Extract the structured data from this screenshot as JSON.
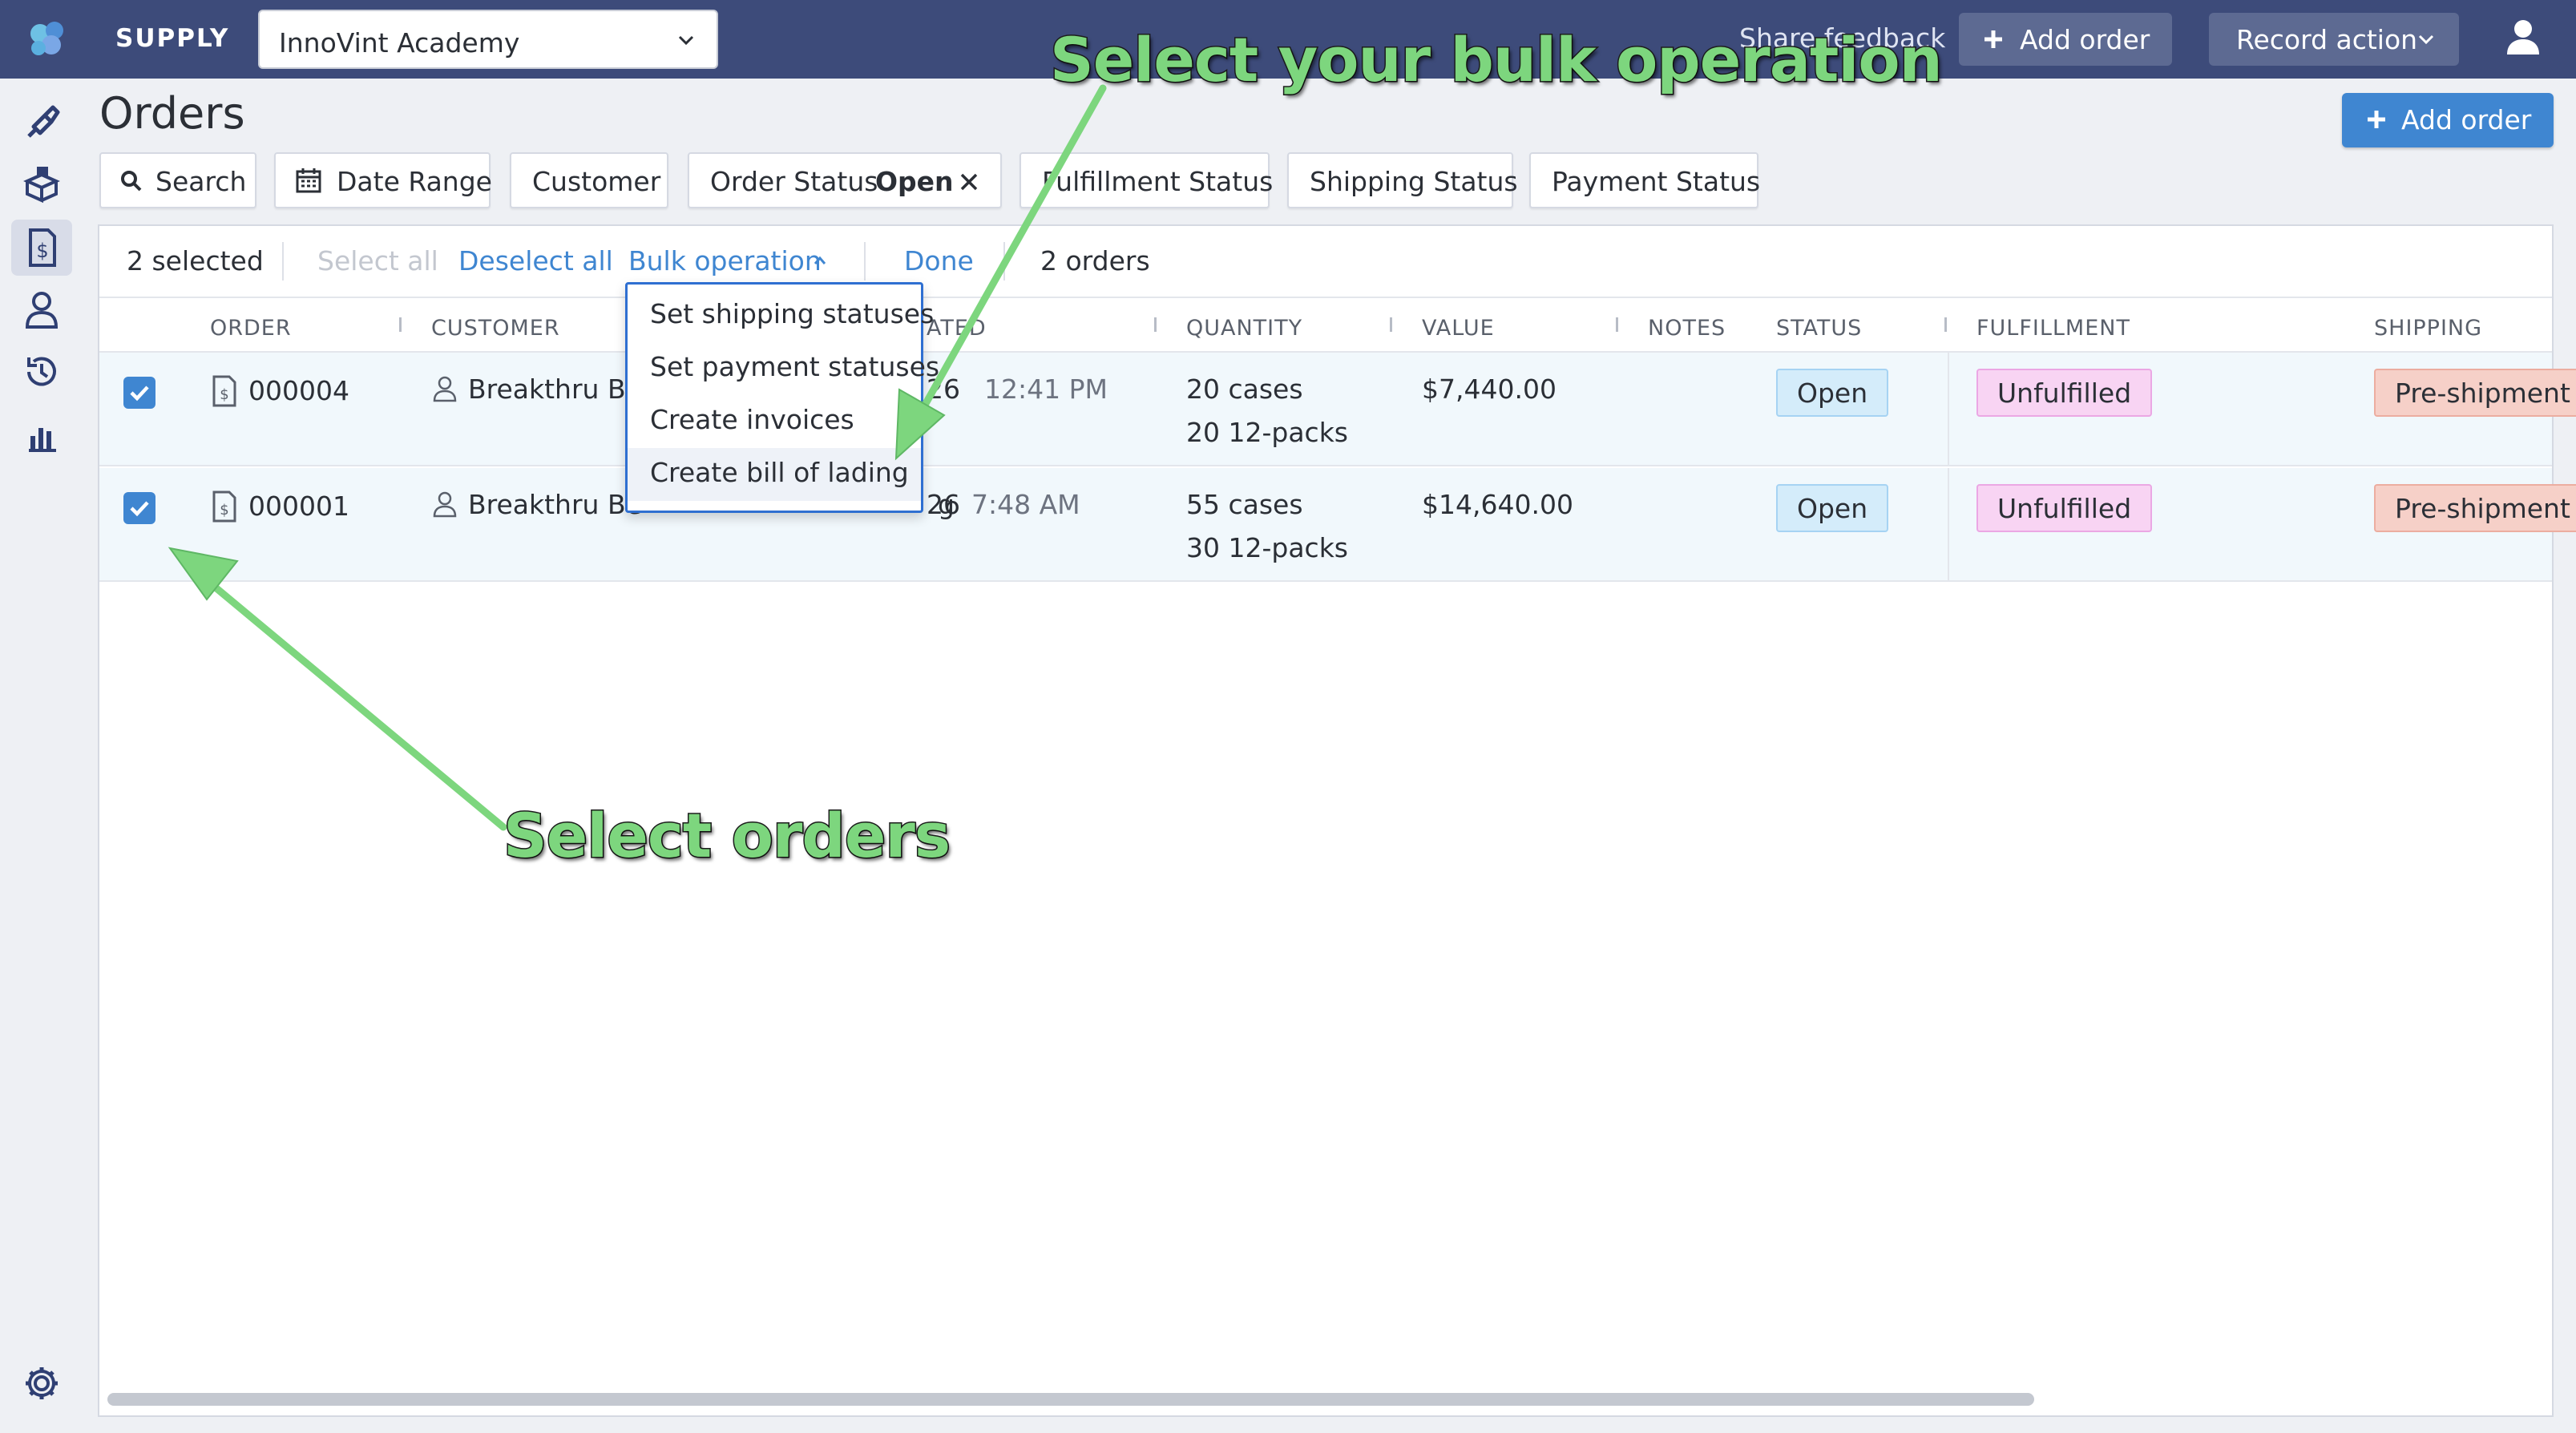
{
  "topbar": {
    "brand": "SUPPLY",
    "org_select_value": "InnoVint Academy",
    "share_feedback": "Share feedback",
    "add_order_label": "Add order",
    "record_action_label": "Record action"
  },
  "rail": {
    "icons": [
      "brush-icon",
      "boxes-icon",
      "orders-icon",
      "customer-icon",
      "history-icon",
      "reports-icon",
      "settings-icon"
    ],
    "active": "orders-icon"
  },
  "page": {
    "title": "Orders",
    "add_order_label": "Add order"
  },
  "filters": {
    "search": "Search",
    "date_range": "Date Range",
    "customer": "Customer",
    "order_status": "Order Status",
    "order_status_value": "Open",
    "fulfillment_status": "Fulfillment Status",
    "shipping_status": "Shipping Status",
    "payment_status": "Payment Status"
  },
  "selection_bar": {
    "selected_count": "2 selected",
    "select_all": "Select all",
    "deselect_all": "Deselect all",
    "bulk_operation": "Bulk operation",
    "done": "Done",
    "order_count": "2 orders"
  },
  "table": {
    "columns": {
      "order": "ORDER",
      "customer": "CUSTOMER",
      "created_fragment": "ATED",
      "quantity": "QUANTITY",
      "value": "VALUE",
      "notes": "NOTES",
      "status": "STATUS",
      "fulfillment": "FULFILLMENT",
      "shipping": "SHIPPING"
    },
    "rows": [
      {
        "order": "000004",
        "customer": "Breakthru Be",
        "date_fragment": "26",
        "time": "12:41 PM",
        "qty_line1": "20 cases",
        "qty_line2": "20 12-packs",
        "value": "$7,440.00",
        "status": "Open",
        "fulfillment": "Unfulfilled",
        "shipping": "Pre-shipment"
      },
      {
        "order": "000001",
        "customer": "Breakthru Be",
        "customer_tail": "g",
        "date_fragment": "26",
        "time": "7:48 AM",
        "qty_line1": "55 cases",
        "qty_line2": "30 12-packs",
        "value": "$14,640.00",
        "status": "Open",
        "fulfillment": "Unfulfilled",
        "shipping": "Pre-shipment"
      }
    ]
  },
  "bulk_menu": {
    "items": [
      "Set shipping statuses",
      "Set payment statuses",
      "Create invoices",
      "Create bill of lading"
    ],
    "highlighted": "Create bill of lading"
  },
  "annotations": {
    "bulk": "Select your bulk operation",
    "orders": "Select orders"
  },
  "colors": {
    "topbar": "#3d4b7a",
    "accent": "#3f86d1",
    "annotation": "#7dd67e",
    "status_open": "#d4ecfa",
    "fulfillment_unfulfilled": "#f8d4f3",
    "shipping_preshipment": "#f6d0c8"
  }
}
